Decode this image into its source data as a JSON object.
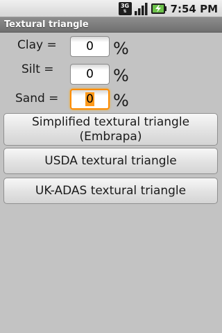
{
  "status_bar": {
    "network_label": "3G",
    "time": "7:54 PM",
    "icons": [
      "3g-data-icon",
      "signal-strength-icon",
      "battery-charging-icon"
    ]
  },
  "title_bar": {
    "title": "Textural triangle"
  },
  "form": {
    "clay": {
      "label": "Clay =",
      "value": "0",
      "unit": "%"
    },
    "silt": {
      "label": "Silt =",
      "value": "0",
      "unit": "%"
    },
    "sand": {
      "label": "Sand =",
      "value": "0",
      "unit": "%"
    }
  },
  "buttons": {
    "embrapa_line1": "Simplified textural triangle",
    "embrapa_line2": "(Embrapa)",
    "usda": "USDA textural triangle",
    "ukadas": "UK-ADAS textural triangle"
  },
  "colors": {
    "background": "#c3c3c3",
    "focus_border": "#ff8c00",
    "title_bar": "#7a7a7a"
  }
}
